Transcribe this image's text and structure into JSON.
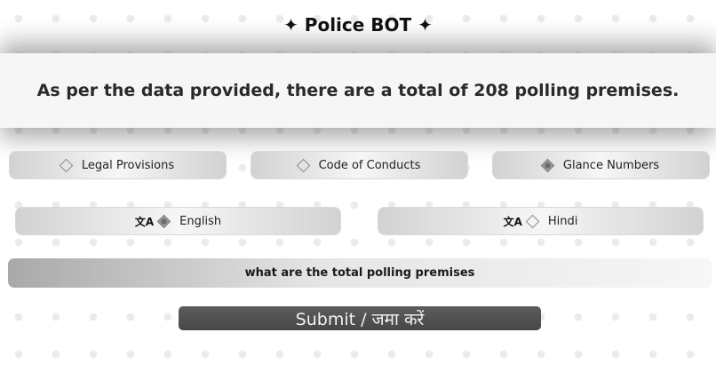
{
  "header": {
    "title": "✦ Police BOT ✦"
  },
  "answer": {
    "text": "As per the data provided, there are a total of 208 polling premises."
  },
  "categories": [
    {
      "label": "Legal Provisions",
      "selected": false
    },
    {
      "label": "Code of Conducts",
      "selected": false
    },
    {
      "label": "Glance Numbers",
      "selected": true
    }
  ],
  "languages": [
    {
      "label": "English",
      "icon": "translate-icon",
      "selected": true
    },
    {
      "label": "Hindi",
      "icon": "translate-icon",
      "selected": false
    }
  ],
  "translate_glyph": "文A",
  "query": {
    "value": "what are the total polling premises"
  },
  "submit": {
    "label": "Submit / जमा करें"
  },
  "colors": {
    "submit_bg": "#4f4f4f",
    "answer_bg": "#f6f6f6"
  }
}
